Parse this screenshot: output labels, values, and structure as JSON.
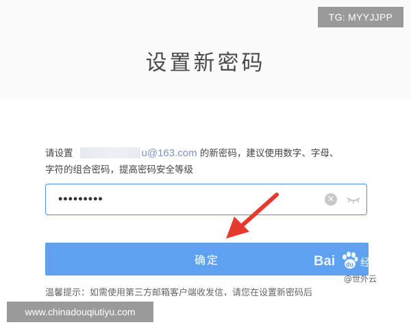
{
  "watermarks": {
    "top_right": "TG: MYYJJPP",
    "bottom_left": "www.chinadouqiutiyu.com"
  },
  "page": {
    "title": "设置新密码"
  },
  "instructions": {
    "prefix": "请设置",
    "email_suffix": "u@163.com",
    "after_email": " 的新密码，建议使用数字、字母、",
    "line2": "字符的组合密码，提高密码安全等级"
  },
  "password_field": {
    "value": "•••••••••"
  },
  "icons": {
    "clear": "clear-icon",
    "visibility": "eye-closed-icon"
  },
  "confirm_button": {
    "label": "确定"
  },
  "baidu_watermark": {
    "brand_left": "Bai",
    "brand_right": "经验",
    "author": "@世外云"
  },
  "tip": {
    "text": "温馨提示：如需使用第三方邮箱客户端收发信，请您在设置新密码后"
  },
  "colors": {
    "accent": "#4d8ff0",
    "button": "#5ea1f0",
    "arrow": "#e8392e"
  }
}
